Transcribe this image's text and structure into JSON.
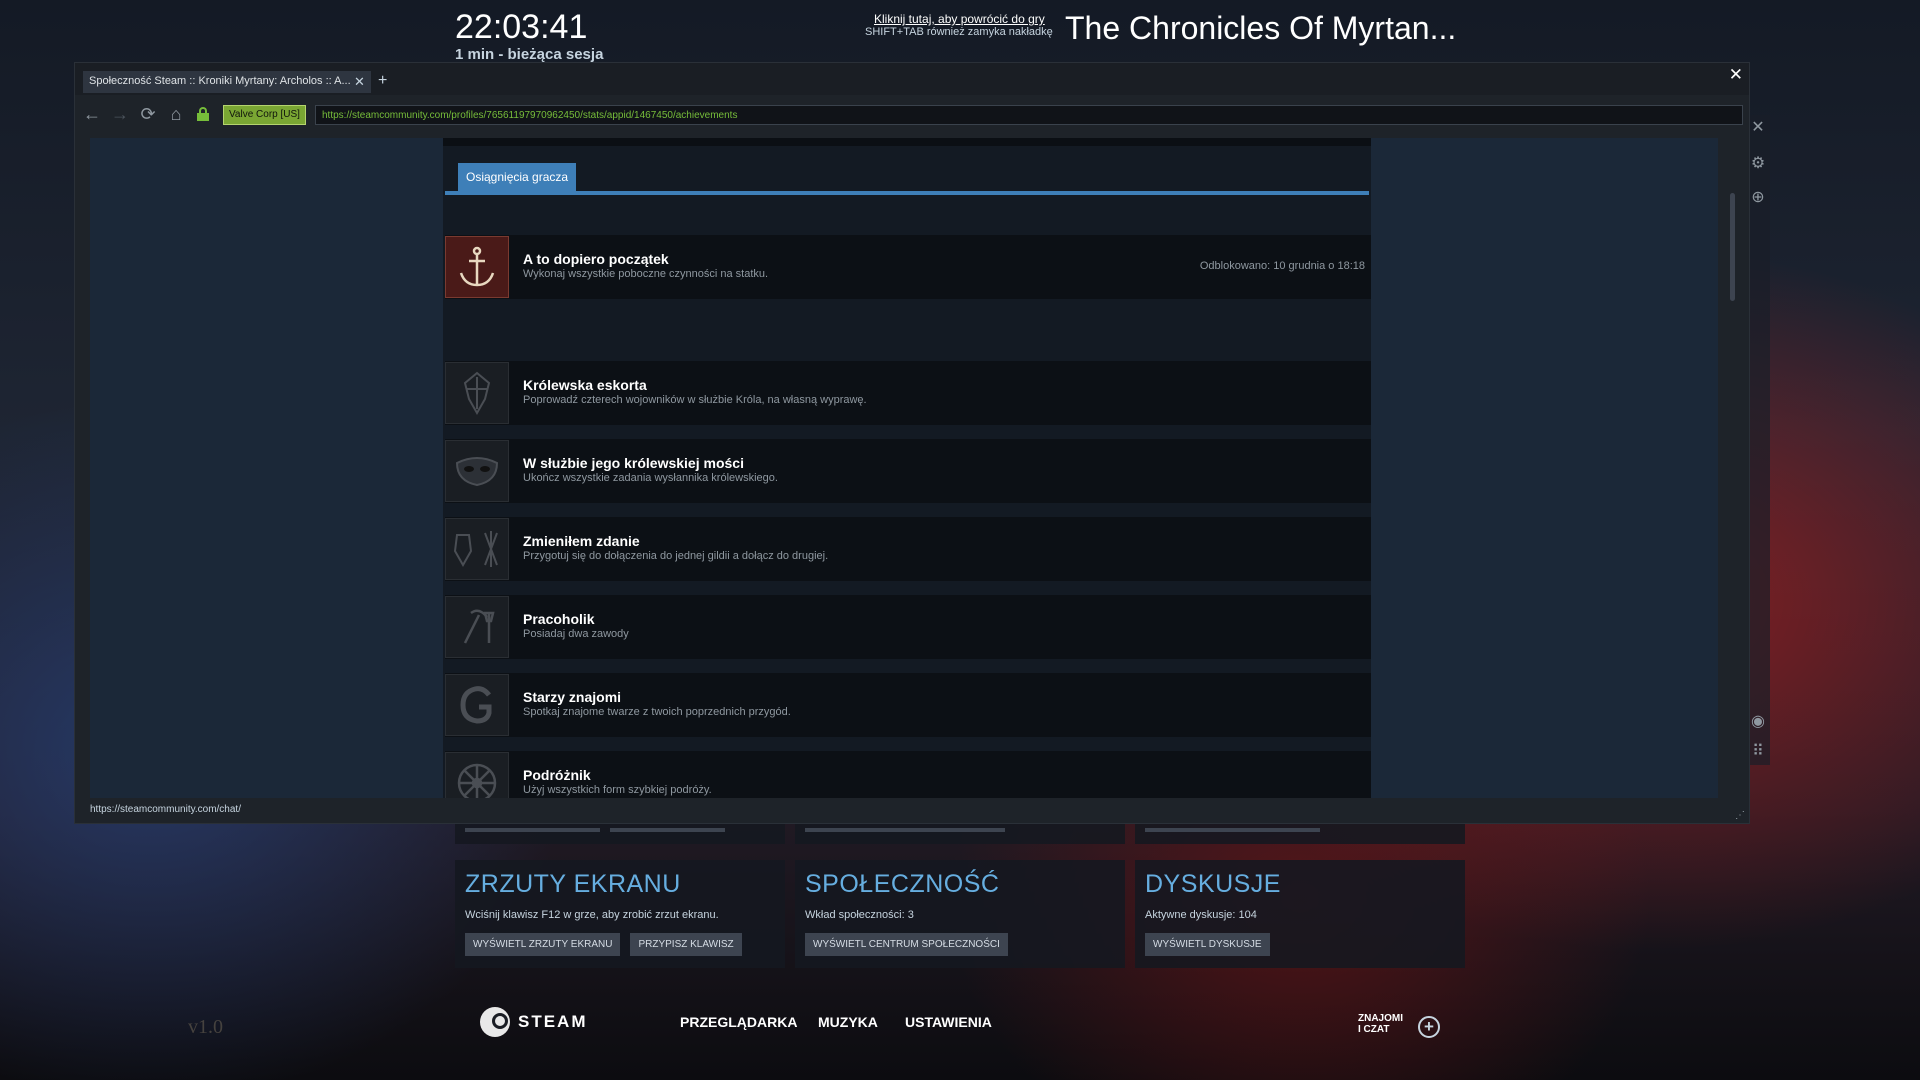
{
  "overlay": {
    "clock": "22:03:41",
    "session": "1 min - bieżąca sesja",
    "return_link": "Kliknij tutaj, aby powrócić do gry",
    "shortcut_hint": "SHIFT+TAB  również zamyka nakładkę",
    "game_title": "The Chronicles Of Myrtan..."
  },
  "browser": {
    "tab_title": "Społeczność Steam :: Kroniki Myrtany: Archolos :: A...",
    "cert_label": "Valve Corp [US]",
    "url": "https://steamcommunity.com/profiles/76561197970962450/stats/appid/1467450/achievements",
    "status_url": "https://steamcommunity.com/chat/"
  },
  "achievements_page": {
    "tab_label": "Osiągnięcia gracza",
    "items": [
      {
        "title": "A to dopiero początek",
        "description": "Wykonaj wszystkie poboczne czynności na statku.",
        "unlocked": "Odblokowano: 10 grudnia o 18:18",
        "icon": "anchor-icon"
      },
      {
        "title": "Królewska eskorta",
        "description": "Poprowadź czterech wojowników w służbie Króla, na własną wyprawę.",
        "unlocked": "",
        "icon": "crest-icon"
      },
      {
        "title": "W służbie jego królewskiej mości",
        "description": "Ukończ wszystkie zadania wysłannika królewskiego.",
        "unlocked": "",
        "icon": "mask-icon"
      },
      {
        "title": "Zmieniłem zdanie",
        "description": "Przygotuj się do dołączenia do jednej gildii a dołącz do drugiej.",
        "unlocked": "",
        "icon": "guild-icon"
      },
      {
        "title": "Pracoholik",
        "description": "Posiadaj dwa zawody",
        "unlocked": "",
        "icon": "tools-icon"
      },
      {
        "title": "Starzy znajomi",
        "description": "Spotkaj znajome twarze z twoich poprzednich przygód.",
        "unlocked": "",
        "icon": "g-letter-icon"
      },
      {
        "title": "Podróżnik",
        "description": "Użyj wszystkich form szybkiej podróży.",
        "unlocked": "",
        "icon": "wheel-icon"
      }
    ]
  },
  "panels": {
    "screenshots": {
      "title": "ZRZUTY EKRANU",
      "desc": "Wciśnij klawisz F12 w grze, aby zrobić zrzut ekranu.",
      "btn1": "WYŚWIETL ZRZUTY EKRANU",
      "btn2": "PRZYPISZ KLAWISZ"
    },
    "community": {
      "title": "SPOŁECZNOŚĆ",
      "desc": "Wkład społeczności: 3",
      "btn1": "WYŚWIETL CENTRUM SPOŁECZNOŚCI"
    },
    "discussions": {
      "title": "DYSKUSJE",
      "desc": "Aktywne dyskusje: 104",
      "btn1": "WYŚWIETL DYSKUSJE"
    }
  },
  "bottom_bar": {
    "steam": "STEAM",
    "browser": "PRZEGLĄDARKA",
    "music": "MUZYKA",
    "settings": "USTAWIENIA",
    "friends_line1": "ZNAJOMI",
    "friends_line2": "I CZAT"
  },
  "version": "v1.0",
  "colors": {
    "accent_blue": "#3e7fb8",
    "panel_title": "#66aee0",
    "secure_green": "#76bd3a"
  }
}
